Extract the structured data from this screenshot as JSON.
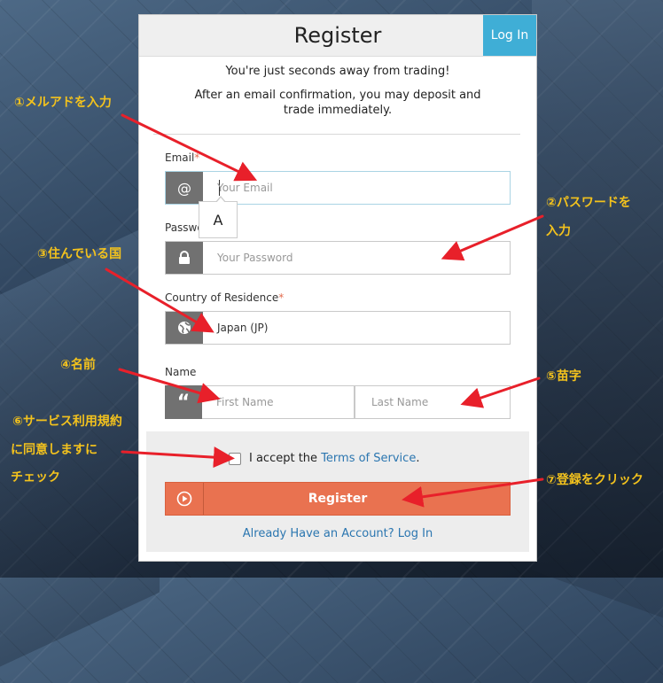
{
  "header": {
    "title": "Register",
    "login_label": "Log In"
  },
  "intro": {
    "line1": "You're just seconds away from trading!",
    "line2": "After an email confirmation, you may deposit and trade immediately."
  },
  "form": {
    "email_label": "Email",
    "email_placeholder": "Your Email",
    "password_label": "Password",
    "password_placeholder": "Your Password",
    "country_label": "Country of Residence",
    "country_value": "Japan (JP)",
    "name_label": "Name",
    "first_name_placeholder": "First Name",
    "last_name_placeholder": "Last Name",
    "required_mark": "*",
    "tooltip_text": "A"
  },
  "footer": {
    "accept_text": "I accept the",
    "terms_link": "Terms of Service",
    "period": ".",
    "register_label": "Register",
    "already_link": "Already Have an Account? Log In"
  },
  "annotations": {
    "a1": "①メルアドを入力",
    "a2_line1": "②パスワードを",
    "a2_line2": "入力",
    "a3": "③住んでいる国",
    "a4": "④名前",
    "a5": "⑤苗字",
    "a6_line1": "⑥サービス利用規約",
    "a6_line2": "に同意しますに",
    "a6_line3": "チェック",
    "a7": "⑦登録をクリック"
  },
  "colors": {
    "accent_blue": "#3faed6",
    "register_orange": "#e97250",
    "annotation_yellow": "#f3c21d",
    "arrow_red": "#e8202a",
    "addon_gray": "#717171"
  },
  "icons": [
    "at-icon",
    "lock-icon",
    "globe-icon",
    "quote-icon",
    "play-circle-icon"
  ]
}
